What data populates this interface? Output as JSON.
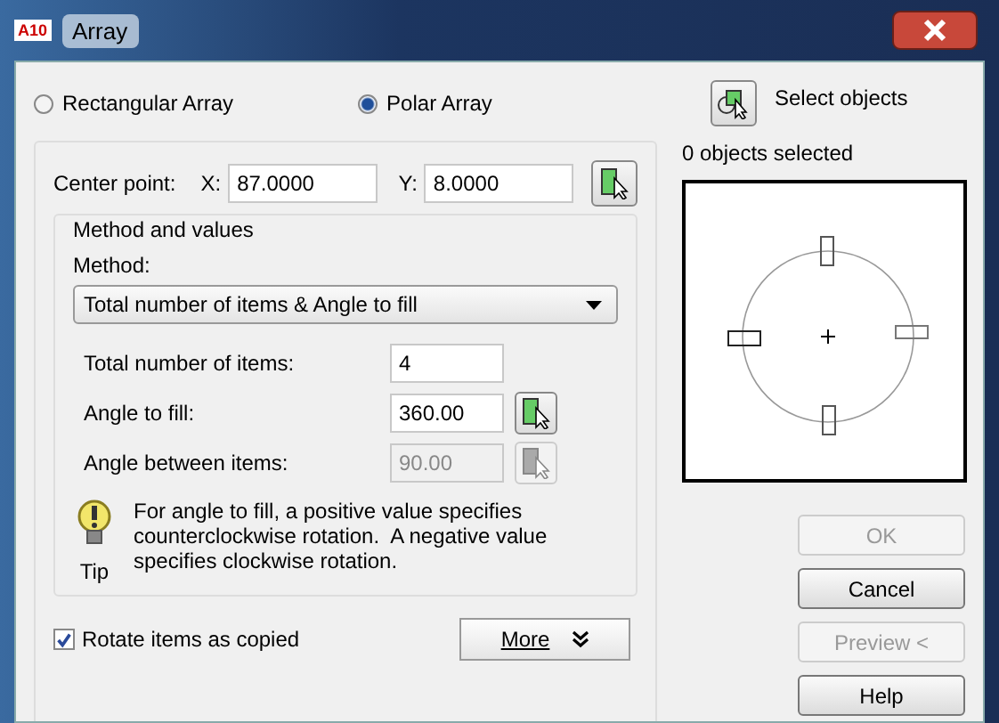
{
  "window": {
    "title": "Array",
    "app_badge": "A10"
  },
  "array_types": [
    {
      "label": "Rectangular Array",
      "selected": false
    },
    {
      "label": "Polar Array",
      "selected": true
    }
  ],
  "select_objects": {
    "label": "Select objects"
  },
  "selection_status": "0 objects selected",
  "center_point": {
    "label": "Center point:",
    "x_label": "X:",
    "x_value": "87.0000",
    "y_label": "Y:",
    "y_value": "8.0000"
  },
  "method_group": {
    "title": "Method and values",
    "method_label": "Method:",
    "method_value": "Total number of items & Angle to fill",
    "fields": [
      {
        "label": "Total number of items:",
        "value": "4",
        "disabled": false,
        "pick_button": false
      },
      {
        "label": "Angle to fill:",
        "value": "360.00",
        "disabled": false,
        "pick_button": true
      },
      {
        "label": "Angle between items:",
        "value": "90.00",
        "disabled": true,
        "pick_button": true
      }
    ]
  },
  "tip": {
    "label": "Tip",
    "text": "For angle to fill, a positive value specifies counterclockwise rotation.  A negative value specifies clockwise rotation."
  },
  "rotate_items": {
    "label": "Rotate items as copied",
    "checked": true
  },
  "more_button": {
    "label": "More"
  },
  "buttons": [
    {
      "label": "OK",
      "disabled": true
    },
    {
      "label": "Cancel",
      "disabled": false
    },
    {
      "label": "Preview <",
      "disabled": true
    },
    {
      "label": "Help",
      "disabled": false
    }
  ]
}
